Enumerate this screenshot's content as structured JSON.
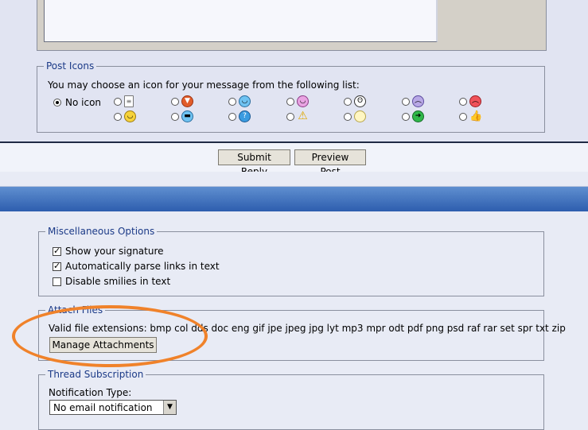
{
  "post_icons": {
    "legend": "Post Icons",
    "instruction": "You may choose an icon for your message from the following list:",
    "no_icon_label": "No icon",
    "icons_row1": [
      "document-icon",
      "thumbs-down-icon",
      "smile-icon",
      "purple-smile-icon",
      "grin-icon",
      "sad-icon",
      "angry-icon"
    ],
    "icons_row2": [
      "yellow-smile-icon",
      "sunglasses-icon",
      "question-icon",
      "warning-icon",
      "lightbulb-icon",
      "arrow-right-icon",
      "thumbs-up-icon"
    ]
  },
  "actions": {
    "submit_label": "Submit Reply",
    "preview_label": "Preview Post"
  },
  "misc": {
    "legend": "Miscellaneous Options",
    "options": [
      {
        "label": "Show your signature",
        "checked": true
      },
      {
        "label": "Automatically parse links in text",
        "checked": true
      },
      {
        "label": "Disable smilies in text",
        "checked": false
      }
    ]
  },
  "attach": {
    "legend": "Attach Files",
    "extensions_text": "Valid file extensions: bmp col dds doc eng gif jpe jpeg jpg lyt mp3 mpr odt pdf png psd raf rar set spr txt zip",
    "manage_label": "Manage Attachments"
  },
  "subscription": {
    "legend": "Thread Subscription",
    "notification_label": "Notification Type:",
    "notification_value": "No email notification"
  },
  "colors": {
    "accent_annotation": "#f0822a",
    "legend_text": "#1b3a87",
    "blue_band": "#2c5cad"
  }
}
